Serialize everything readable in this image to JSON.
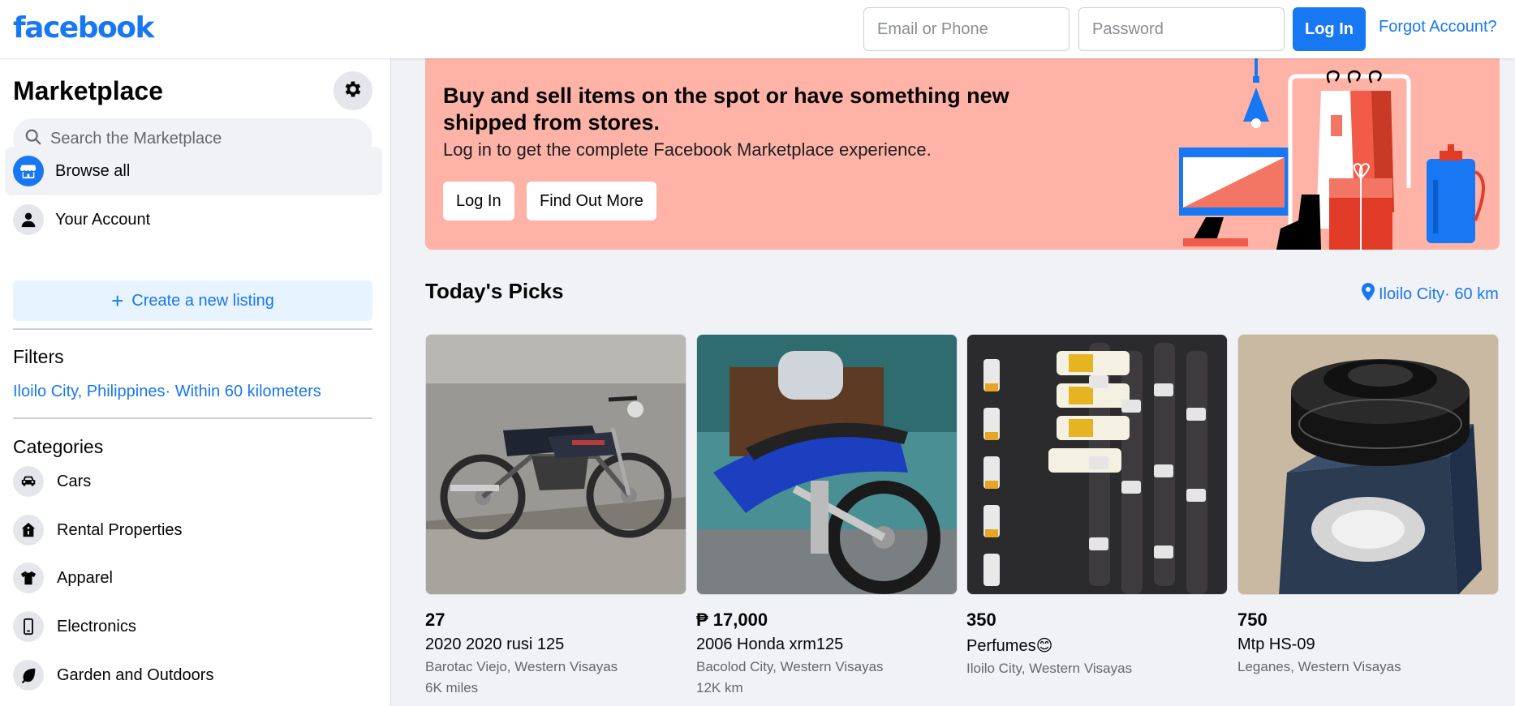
{
  "header": {
    "logo": "facebook",
    "email_placeholder": "Email or Phone",
    "password_placeholder": "Password",
    "login_label": "Log In",
    "forgot_label": "Forgot Account?"
  },
  "sidebar": {
    "title": "Marketplace",
    "search_placeholder": "Search the Marketplace",
    "nav": [
      {
        "label": "Browse all",
        "icon": "storefront-icon"
      },
      {
        "label": "Your Account",
        "icon": "person-icon"
      }
    ],
    "create_label": "Create a new listing",
    "filters_title": "Filters",
    "filter_location": "Iloilo City, Philippines· Within 60 kilometers",
    "categories_title": "Categories",
    "categories": [
      {
        "label": "Cars",
        "icon": "car-icon"
      },
      {
        "label": "Rental Properties",
        "icon": "house-icon"
      },
      {
        "label": "Apparel",
        "icon": "shirt-icon"
      },
      {
        "label": "Electronics",
        "icon": "phone-icon"
      },
      {
        "label": "Garden and Outdoors",
        "icon": "leaf-icon"
      }
    ]
  },
  "banner": {
    "title": "Buy and sell items on the spot or have something new shipped from stores.",
    "subtitle": "Log in to get the complete Facebook Marketplace experience.",
    "login_label": "Log In",
    "more_label": "Find Out More"
  },
  "picks": {
    "title": "Today's Picks",
    "location": "Iloilo City· 60 km",
    "items": [
      {
        "price": "27",
        "title": "2020 2020 rusi 125",
        "location": "Barotac Viejo, Western Visayas",
        "meta": "6K miles",
        "image": "motorcycle-photo"
      },
      {
        "price": "₱ 17,000",
        "title": "2006 Honda xrm125",
        "location": "Bacolod City, Western Visayas",
        "meta": "12K km",
        "image": "blue-motorcycle-photo"
      },
      {
        "price": "350",
        "title": "Perfumes😊",
        "location": "Iloilo City, Western Visayas",
        "meta": "",
        "image": "perfume-bottles-photo"
      },
      {
        "price": "750",
        "title": "Mtp HS-09",
        "location": "Leganes, Western Visayas",
        "meta": "",
        "image": "bike-headset-photo"
      }
    ]
  },
  "colors": {
    "brand": "#1877f2",
    "banner_bg": "#ffb3a7",
    "page_bg": "#f0f2f5"
  }
}
